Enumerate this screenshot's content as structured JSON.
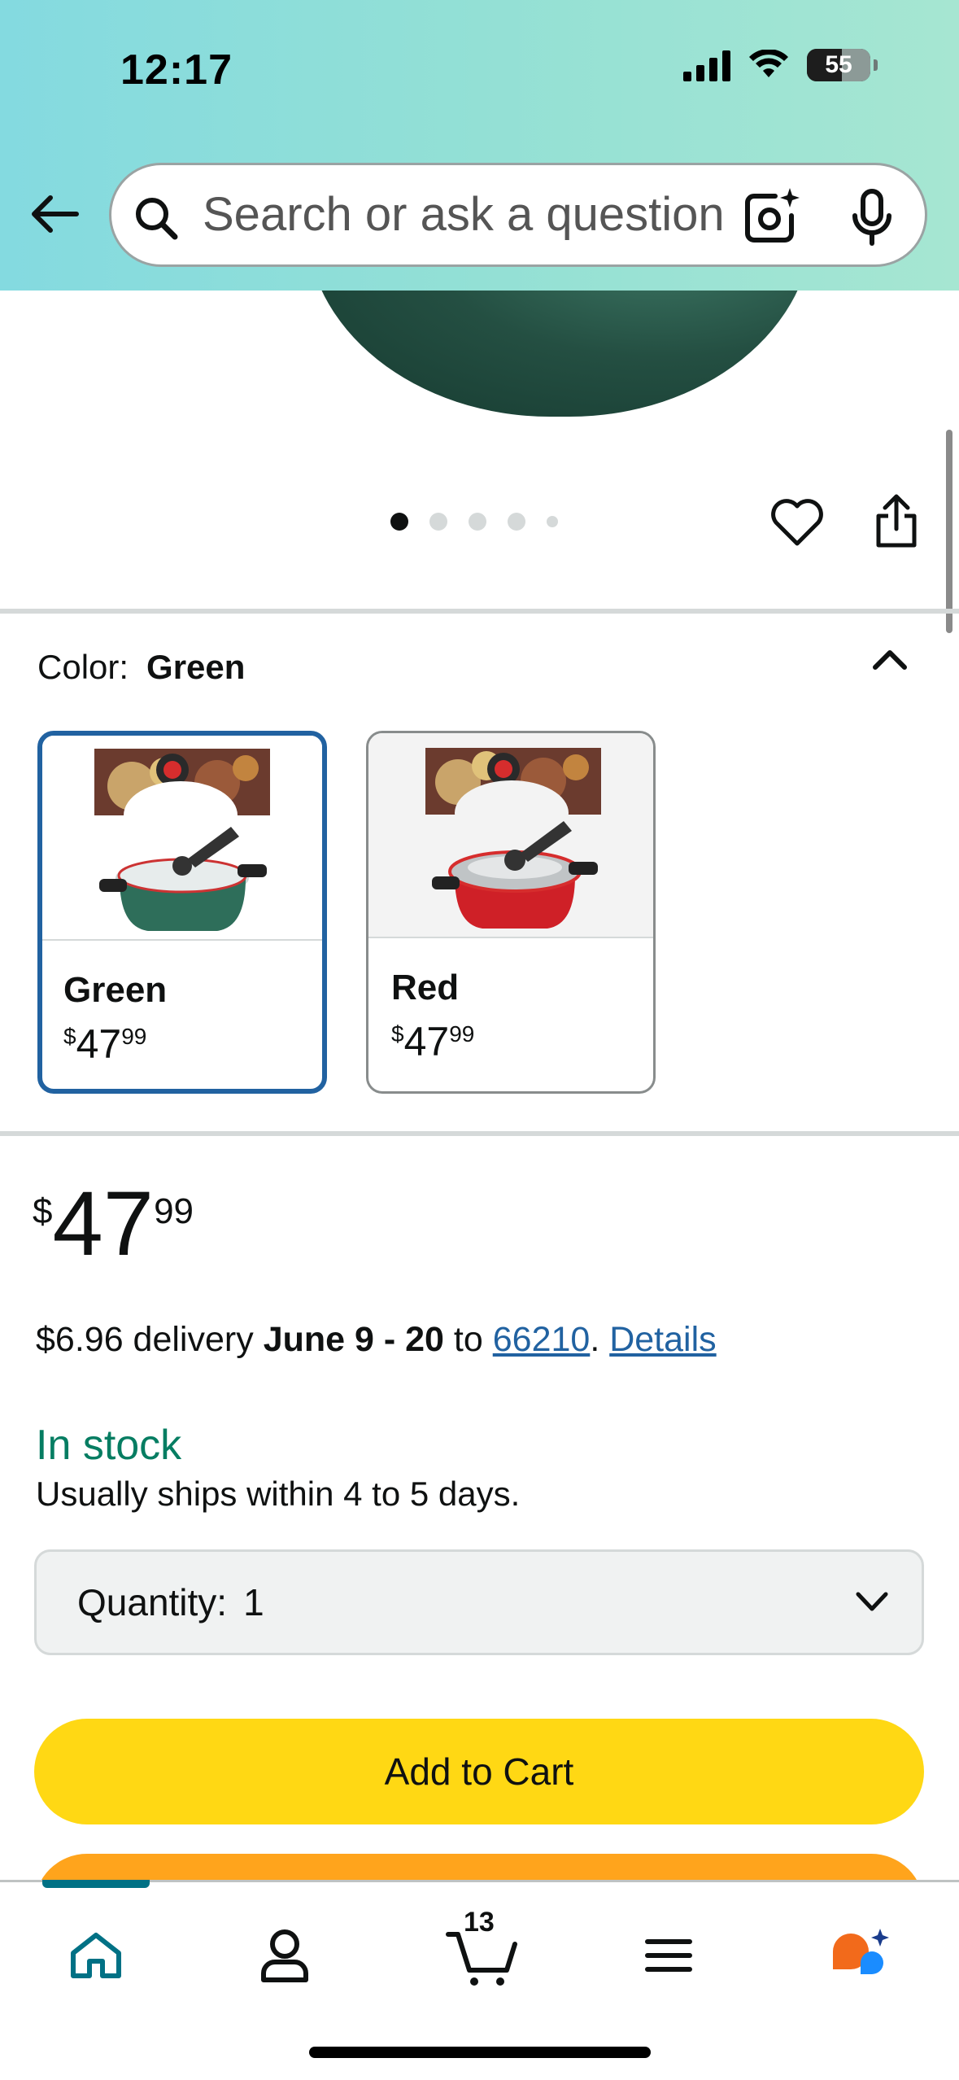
{
  "status_bar": {
    "time": "12:17",
    "battery": "55"
  },
  "search": {
    "placeholder": "Search or ask a question"
  },
  "product_image": {
    "dots_total": 5,
    "dots_active_index": 0
  },
  "color": {
    "label": "Color:",
    "selected": "Green",
    "options": [
      {
        "name": "Green",
        "currency": "$",
        "whole": "47",
        "fraction": "99",
        "selected": true
      },
      {
        "name": "Red",
        "currency": "$",
        "whole": "47",
        "fraction": "99",
        "selected": false
      }
    ]
  },
  "price": {
    "currency": "$",
    "whole": "47",
    "fraction": "99"
  },
  "delivery": {
    "cost": "$6.96 delivery",
    "dates": "June 9 - 20",
    "to": "to",
    "zip": "66210",
    "punct": ".",
    "details_link": "Details"
  },
  "stock": {
    "status": "In stock",
    "ships": "Usually ships within 4 to 5 days."
  },
  "quantity": {
    "label": "Quantity:",
    "value": "1"
  },
  "buttons": {
    "add_to_cart": "Add to Cart"
  },
  "bottom_nav": {
    "cart_count": "13",
    "active": "home"
  },
  "colors": {
    "header_start": "#84dae0",
    "header_end": "#a6e6d2",
    "selected_border": "#2162a1",
    "link": "#2162a1",
    "in_stock": "#067d62",
    "add_to_cart": "#ffd814",
    "buy_now": "#ffa41c",
    "nav_active": "#007185"
  },
  "icons": [
    "back-arrow-icon",
    "search-icon",
    "camera-lens-icon",
    "microphone-icon",
    "heart-icon",
    "share-icon",
    "chevron-up-icon",
    "chevron-down-icon",
    "home-icon",
    "profile-icon",
    "cart-icon",
    "menu-icon",
    "rufus-ai-icon"
  ]
}
